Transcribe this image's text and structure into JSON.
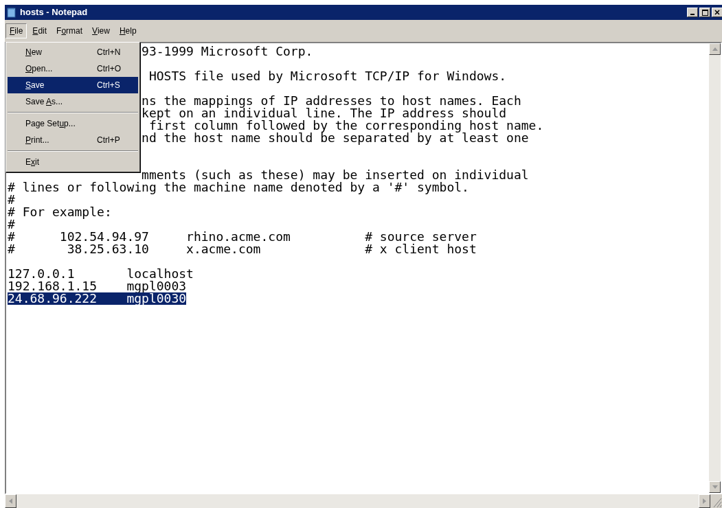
{
  "window": {
    "title": "hosts - Notepad"
  },
  "menubar": [
    {
      "label": [
        {
          "t": "F",
          "u": true
        },
        {
          "t": "ile"
        }
      ],
      "selected": true
    },
    {
      "label": [
        {
          "t": "E",
          "u": true
        },
        {
          "t": "dit"
        }
      ],
      "selected": false
    },
    {
      "label": [
        {
          "t": "F"
        },
        {
          "t": "o",
          "u": true
        },
        {
          "t": "rmat"
        }
      ],
      "selected": false
    },
    {
      "label": [
        {
          "t": "V",
          "u": true
        },
        {
          "t": "iew"
        }
      ],
      "selected": false
    },
    {
      "label": [
        {
          "t": "H",
          "u": true
        },
        {
          "t": "elp"
        }
      ],
      "selected": false
    }
  ],
  "file_menu": [
    {
      "kind": "item",
      "label": [
        {
          "t": "N",
          "u": true
        },
        {
          "t": "ew"
        }
      ],
      "shortcut": "Ctrl+N",
      "selected": false
    },
    {
      "kind": "item",
      "label": [
        {
          "t": "O",
          "u": true
        },
        {
          "t": "pen..."
        }
      ],
      "shortcut": "Ctrl+O",
      "selected": false
    },
    {
      "kind": "item",
      "label": [
        {
          "t": "S",
          "u": true
        },
        {
          "t": "ave"
        }
      ],
      "shortcut": "Ctrl+S",
      "selected": true
    },
    {
      "kind": "item",
      "label": [
        {
          "t": "Save "
        },
        {
          "t": "A",
          "u": true
        },
        {
          "t": "s..."
        }
      ],
      "selected": false
    },
    {
      "kind": "separator"
    },
    {
      "kind": "item",
      "label": [
        {
          "t": "Page Set"
        },
        {
          "t": "u",
          "u": true
        },
        {
          "t": "p..."
        }
      ],
      "selected": false
    },
    {
      "kind": "item",
      "label": [
        {
          "t": "P",
          "u": true
        },
        {
          "t": "rint..."
        }
      ],
      "shortcut": "Ctrl+P",
      "selected": false
    },
    {
      "kind": "separator"
    },
    {
      "kind": "item",
      "label": [
        {
          "t": "E"
        },
        {
          "t": "x",
          "u": true
        },
        {
          "t": "it"
        }
      ],
      "selected": false
    }
  ],
  "editor_lines": [
    {
      "kind": "covered",
      "text": "93-1999 Microsoft Corp."
    },
    {
      "kind": "blank"
    },
    {
      "kind": "covered",
      "text": " HOSTS file used by Microsoft TCP/IP for Windows."
    },
    {
      "kind": "blank"
    },
    {
      "kind": "covered",
      "text": "ns the mappings of IP addresses to host names. Each"
    },
    {
      "kind": "covered",
      "text": "kept on an individual line. The IP address should"
    },
    {
      "kind": "covered",
      "text": " first column followed by the corresponding host name."
    },
    {
      "kind": "covered",
      "text": "nd the host name should be separated by at least one"
    },
    {
      "kind": "blank"
    },
    {
      "kind": "blank"
    },
    {
      "kind": "covered",
      "text": "mments (such as these) may be inserted on individual"
    },
    {
      "kind": "text",
      "text": "# lines or following the machine name denoted by a '#' symbol.",
      "selected": false
    },
    {
      "kind": "text",
      "text": "#",
      "selected": false
    },
    {
      "kind": "text",
      "text": "# For example:",
      "selected": false
    },
    {
      "kind": "text",
      "text": "#",
      "selected": false
    },
    {
      "kind": "text",
      "text": "#      102.54.94.97     rhino.acme.com          # source server",
      "selected": false
    },
    {
      "kind": "text",
      "text": "#       38.25.63.10     x.acme.com              # x client host",
      "selected": false
    },
    {
      "kind": "blank"
    },
    {
      "kind": "text",
      "text": "127.0.0.1       localhost",
      "selected": false
    },
    {
      "kind": "text",
      "text": "192.168.1.15    mgpl0003",
      "selected": false
    },
    {
      "kind": "text",
      "text": "24.68.96.222    mgpl0030",
      "selected": true
    }
  ]
}
